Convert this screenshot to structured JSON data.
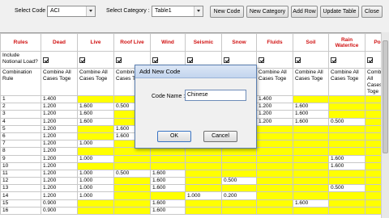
{
  "toolbar": {
    "code_label": "Select Code :",
    "code_value": "ACI",
    "category_label": "Select Category :",
    "category_value": "Table1",
    "buttons": [
      "New Code",
      "New Category",
      "Add Row",
      "Update Table",
      "Close"
    ]
  },
  "grid": {
    "headers": [
      "Rules",
      "Dead",
      "Live",
      "Roof Live",
      "Wind",
      "Seismic",
      "Snow",
      "Fluids",
      "Soil",
      "Rain Water/Ice",
      "Po"
    ],
    "notional_label": "Include Notional Load?",
    "combination_label": "Combination Rule",
    "combination_text": "Combine All Cases Toge",
    "row_numbers": [
      "1",
      "2",
      "3",
      "4",
      "5",
      "6",
      "7",
      "8",
      "9",
      "10",
      "11",
      "12",
      "13",
      "14",
      "15",
      "16"
    ],
    "rows": [
      [
        "1.400",
        "",
        "",
        "",
        "",
        "",
        "1.400",
        "",
        "",
        ""
      ],
      [
        "1.200",
        "1.600",
        "0.500",
        "",
        "",
        "",
        "1.200",
        "1.600",
        "",
        ""
      ],
      [
        "1.200",
        "1.600",
        "",
        "",
        "",
        "",
        "1.200",
        "1.600",
        "",
        ""
      ],
      [
        "1.200",
        "1.600",
        "",
        "",
        "",
        "",
        "1.200",
        "1.600",
        "0.500",
        ""
      ],
      [
        "1.200",
        "",
        "1.600",
        "",
        "",
        "",
        "",
        "",
        "",
        ""
      ],
      [
        "1.200",
        "",
        "1.600",
        "",
        "",
        "",
        "",
        "",
        "",
        ""
      ],
      [
        "1.200",
        "1.000",
        "",
        "",
        "",
        "",
        "",
        "",
        "",
        ""
      ],
      [
        "1.200",
        "",
        "",
        "",
        "",
        "",
        "",
        "",
        "",
        ""
      ],
      [
        "1.200",
        "1.000",
        "",
        "",
        "",
        "",
        "",
        "",
        "1.600",
        ""
      ],
      [
        "1.200",
        "",
        "",
        "",
        "",
        "",
        "",
        "",
        "1.600",
        ""
      ],
      [
        "1.200",
        "1.000",
        "0.500",
        "1.600",
        "",
        "",
        "",
        "",
        "",
        ""
      ],
      [
        "1.200",
        "1.000",
        "",
        "1.600",
        "",
        "0.500",
        "",
        "",
        "",
        ""
      ],
      [
        "1.200",
        "1.000",
        "",
        "1.600",
        "",
        "",
        "",
        "",
        "0.500",
        ""
      ],
      [
        "1.200",
        "1.000",
        "",
        "",
        "1.000",
        "0.200",
        "",
        "",
        "",
        ""
      ],
      [
        "0.900",
        "",
        "",
        "1.600",
        "",
        "",
        "",
        "1.600",
        "",
        ""
      ],
      [
        "0.900",
        "",
        "",
        "1.600",
        "",
        "",
        "",
        "",
        "",
        ""
      ]
    ]
  },
  "dialog": {
    "title": "Add New Code",
    "field_label": "Code Name :",
    "field_value": "Chinese",
    "ok_label": "OK",
    "cancel_label": "Cancel"
  },
  "colors": {
    "cell_highlight": "#ffff00",
    "header_text": "#d01010"
  }
}
